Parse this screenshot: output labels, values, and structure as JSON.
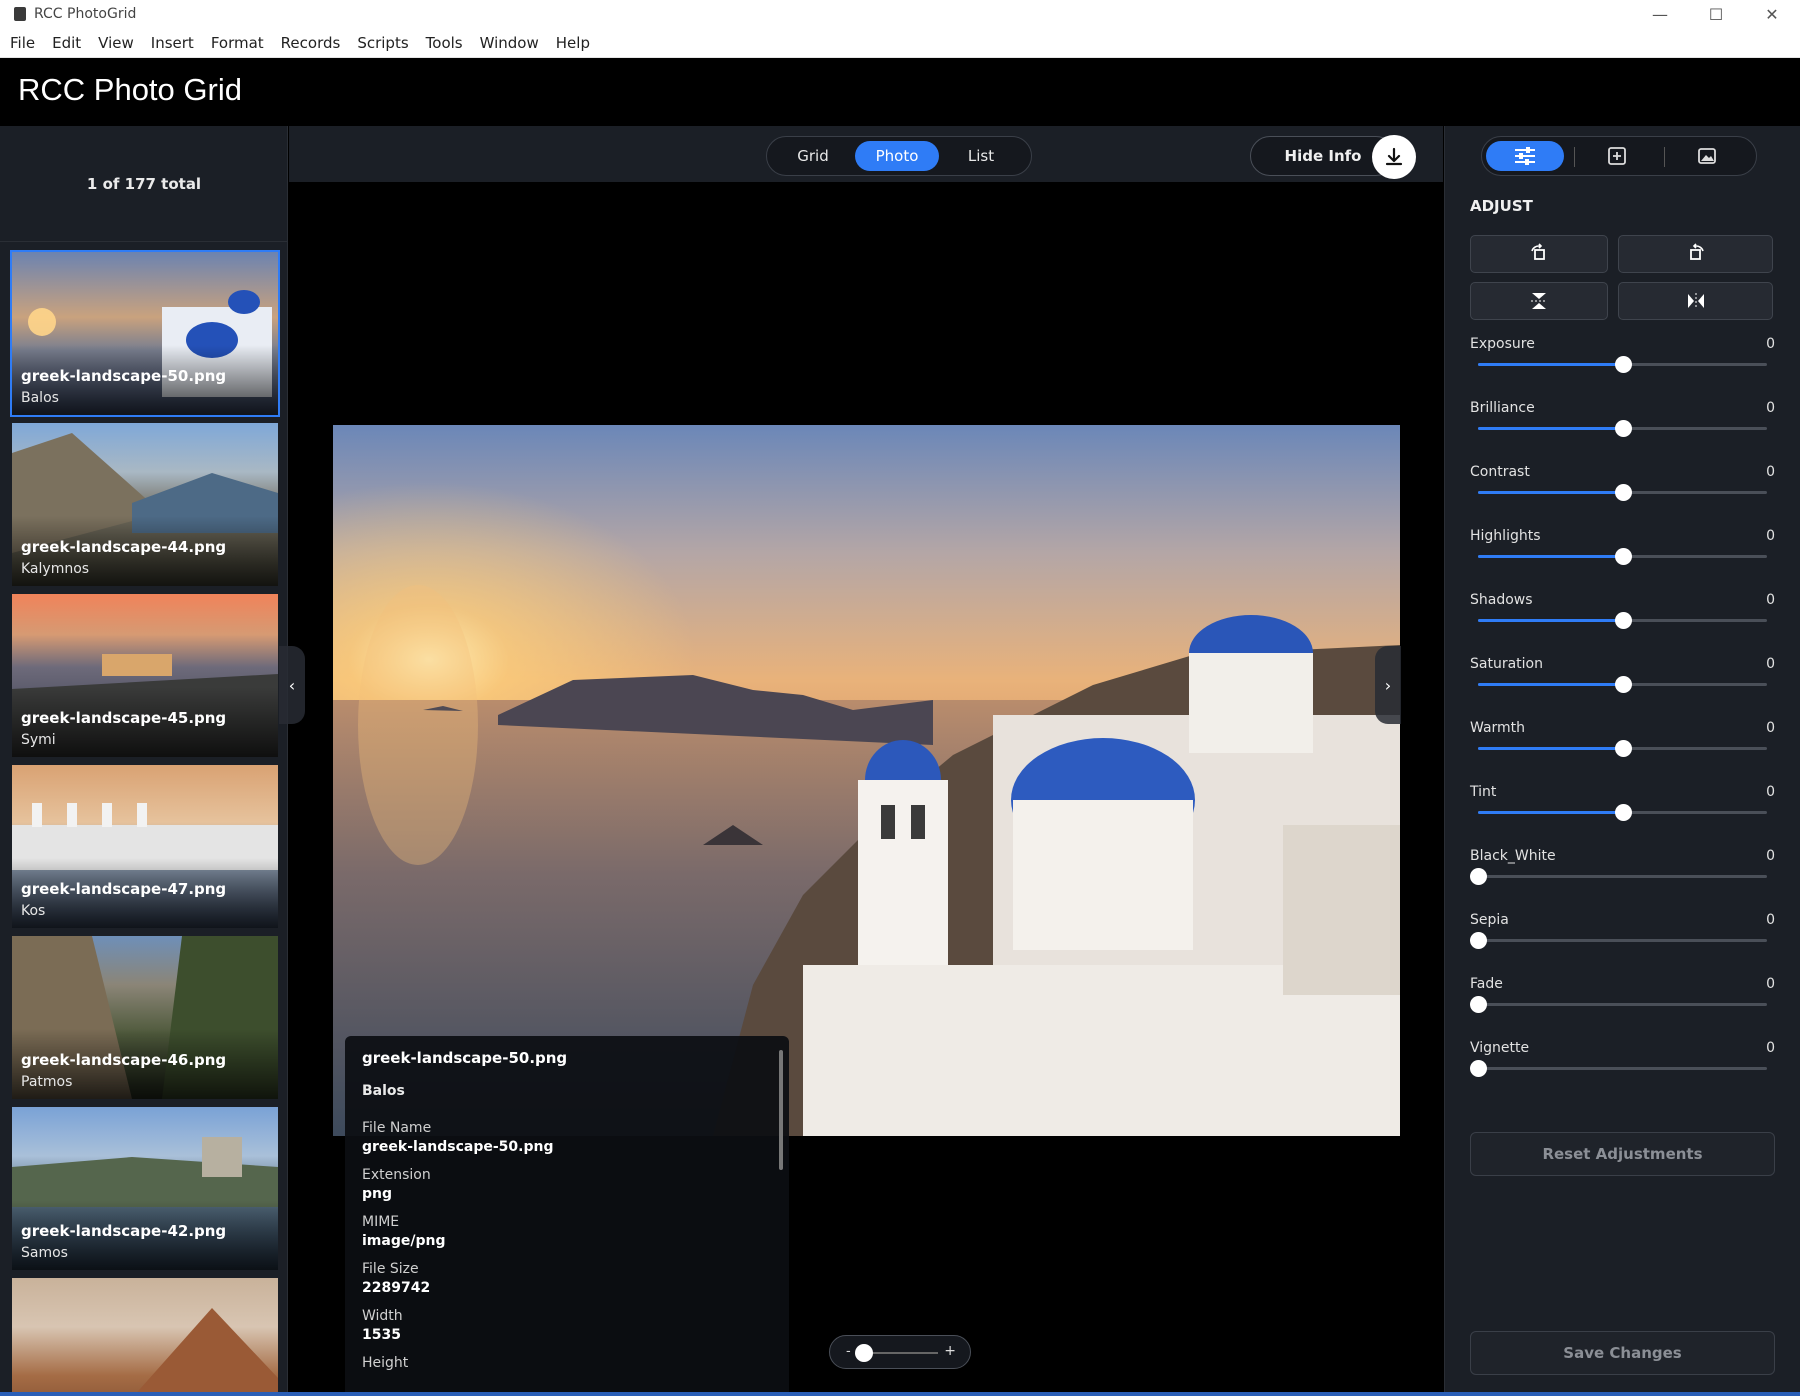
{
  "window": {
    "title": "RCC PhotoGrid",
    "controls": [
      "minimize",
      "maximize",
      "close"
    ]
  },
  "menu": [
    "File",
    "Edit",
    "View",
    "Insert",
    "Format",
    "Records",
    "Scripts",
    "Tools",
    "Window",
    "Help"
  ],
  "app": {
    "title": "RCC Photo Grid"
  },
  "sidebar": {
    "count_text": "1 of 177 total",
    "items": [
      {
        "name": "greek-landscape-50.png",
        "place": "Balos",
        "active": true
      },
      {
        "name": "greek-landscape-44.png",
        "place": "Kalymnos",
        "active": false
      },
      {
        "name": "greek-landscape-45.png",
        "place": "Symi",
        "active": false
      },
      {
        "name": "greek-landscape-47.png",
        "place": "Kos",
        "active": false
      },
      {
        "name": "greek-landscape-46.png",
        "place": "Patmos",
        "active": false
      },
      {
        "name": "greek-landscape-42.png",
        "place": "Samos",
        "active": false
      }
    ]
  },
  "toolbar": {
    "view_modes": [
      "Grid",
      "Photo",
      "List"
    ],
    "active_mode": "Photo",
    "hide_info_label": "Hide Info",
    "download_icon": "download-icon"
  },
  "viewer": {
    "prev_arrow": "‹",
    "next_arrow": "›"
  },
  "info": {
    "title": "greek-landscape-50.png",
    "subtitle": "Balos",
    "fields": [
      {
        "key": "File Name",
        "value": "greek-landscape-50.png"
      },
      {
        "key": "Extension",
        "value": "png"
      },
      {
        "key": "MIME",
        "value": "image/png"
      },
      {
        "key": "File Size",
        "value": "2289742"
      },
      {
        "key": "Width",
        "value": "1535"
      },
      {
        "key": "Height",
        "value": ""
      }
    ]
  },
  "zoom": {
    "minus": "-",
    "plus": "+"
  },
  "panel": {
    "tabs": [
      "adjust-sliders-icon",
      "export-icon",
      "image-icon"
    ],
    "active_tab": 0,
    "section_title": "ADJUST",
    "tools": [
      "rotate-left-icon",
      "rotate-right-icon",
      "flip-vertical-icon",
      "flip-horizontal-icon"
    ],
    "sliders": [
      {
        "label": "Exposure",
        "value": "0",
        "position": 0.5
      },
      {
        "label": "Brilliance",
        "value": "0",
        "position": 0.5
      },
      {
        "label": "Contrast",
        "value": "0",
        "position": 0.5
      },
      {
        "label": "Highlights",
        "value": "0",
        "position": 0.5
      },
      {
        "label": "Shadows",
        "value": "0",
        "position": 0.5
      },
      {
        "label": "Saturation",
        "value": "0",
        "position": 0.5
      },
      {
        "label": "Warmth",
        "value": "0",
        "position": 0.5
      },
      {
        "label": "Tint",
        "value": "0",
        "position": 0.5
      },
      {
        "label": "Black_White",
        "value": "0",
        "position": 0
      },
      {
        "label": "Sepia",
        "value": "0",
        "position": 0
      },
      {
        "label": "Fade",
        "value": "0",
        "position": 0
      },
      {
        "label": "Vignette",
        "value": "0",
        "position": 0
      }
    ],
    "reset_label": "Reset Adjustments",
    "save_label": "Save Changes"
  },
  "colors": {
    "accent": "#2f7cf6",
    "panel_bg": "#1b1f26",
    "viewer_bg": "#000000"
  }
}
